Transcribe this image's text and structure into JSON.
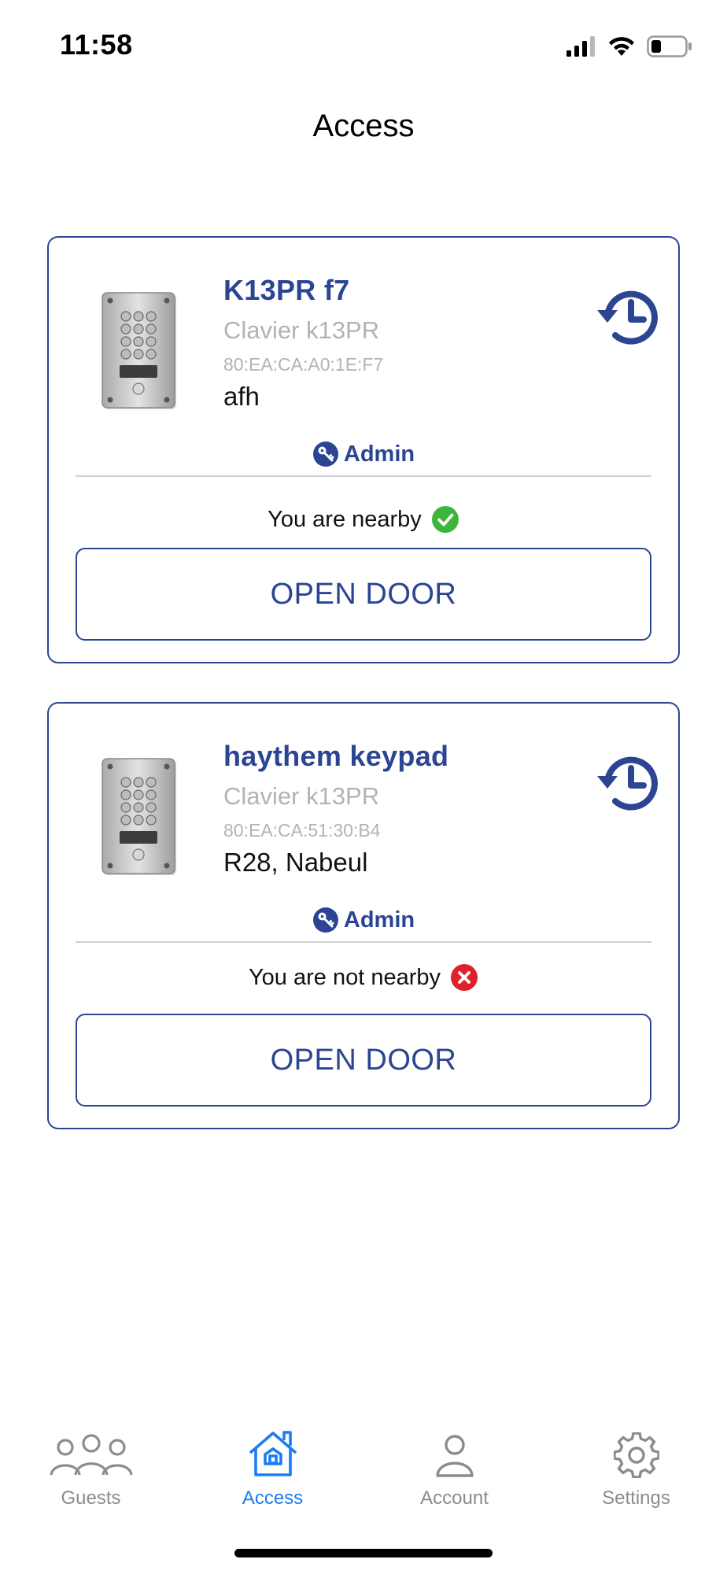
{
  "status_bar": {
    "time": "11:58",
    "icons": [
      "signal-icon",
      "wifi-icon",
      "battery-icon"
    ]
  },
  "header": {
    "title": "Access"
  },
  "devices": [
    {
      "name": "K13PR f7",
      "model": "Clavier k13PR",
      "mac": "80:EA:CA:A0:1E:F7",
      "location": "afh",
      "role": "Admin",
      "nearby_text": "You are nearby",
      "nearby": true,
      "open_label": "OPEN DOOR"
    },
    {
      "name": "haythem keypad",
      "model": "Clavier k13PR",
      "mac": "80:EA:CA:51:30:B4",
      "location": "R28, Nabeul",
      "role": "Admin",
      "nearby_text": "You are not nearby",
      "nearby": false,
      "open_label": "OPEN DOOR"
    }
  ],
  "tabs": [
    {
      "label": "Guests",
      "icon": "guests-icon",
      "active": false
    },
    {
      "label": "Access",
      "icon": "home-icon",
      "active": true
    },
    {
      "label": "Account",
      "icon": "person-icon",
      "active": false
    },
    {
      "label": "Settings",
      "icon": "gear-icon",
      "active": false
    }
  ],
  "colors": {
    "brand": "#2b4593",
    "tab_active": "#1c7cf3",
    "tab_inactive": "#8c8c8c",
    "nearby_ok": "#3cb53c",
    "nearby_no": "#e0212a"
  }
}
